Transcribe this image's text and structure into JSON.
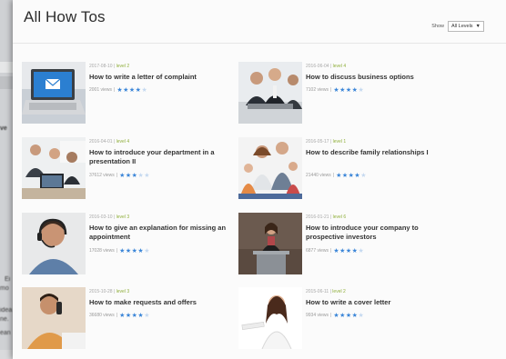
{
  "page": {
    "title": "All How Tos"
  },
  "filter": {
    "show_label": "Show",
    "level_value": "All Levels",
    "arrow": "▼"
  },
  "background": {
    "snippets": [
      "ve",
      "Ei",
      "mo",
      "idea",
      "ne.",
      "ean"
    ]
  },
  "cards": [
    {
      "date": "2017-08-10",
      "level": "level 2",
      "title": "How to write a letter of complaint",
      "views": "2001 views",
      "stars_on": "★★★★",
      "stars_off": "★",
      "thumb": "laptop-icon"
    },
    {
      "date": "2016-06-04",
      "level": "level 4",
      "title": "How to discuss business options",
      "views": "7102 views",
      "stars_on": "★★★★",
      "stars_off": "★",
      "thumb": "business-meeting-icon"
    },
    {
      "date": "2016-04-01",
      "level": "level 4",
      "title": "How to introduce your department in a presentation II",
      "views": "37612 views",
      "stars_on": "★★★",
      "stars_off": "★★",
      "thumb": "presentation-icon"
    },
    {
      "date": "2016-05-17",
      "level": "level 1",
      "title": "How to describe family relationships I",
      "views": "21440 views",
      "stars_on": "★★★★",
      "stars_off": "★",
      "thumb": "family-icon"
    },
    {
      "date": "2016-03-10",
      "level": "level 3",
      "title": "How to give an explanation for missing an appointment",
      "views": "17028 views",
      "stars_on": "★★★★",
      "stars_off": "★",
      "thumb": "headset-man-icon"
    },
    {
      "date": "2016-01-21",
      "level": "level 6",
      "title": "How to introduce your company to prospective investors",
      "views": "6877 views",
      "stars_on": "★★★★",
      "stars_off": "★",
      "thumb": "speaker-podium-icon"
    },
    {
      "date": "2015-10-28",
      "level": "level 3",
      "title": "How to make requests and offers",
      "views": "36680 views",
      "stars_on": "★★★★",
      "stars_off": "★",
      "thumb": "phone-man-icon"
    },
    {
      "date": "2015-06-11",
      "level": "level 2",
      "title": "How to write a cover letter",
      "views": "9934 views",
      "stars_on": "★★★★",
      "stars_off": "★",
      "thumb": "woman-card-icon"
    }
  ]
}
